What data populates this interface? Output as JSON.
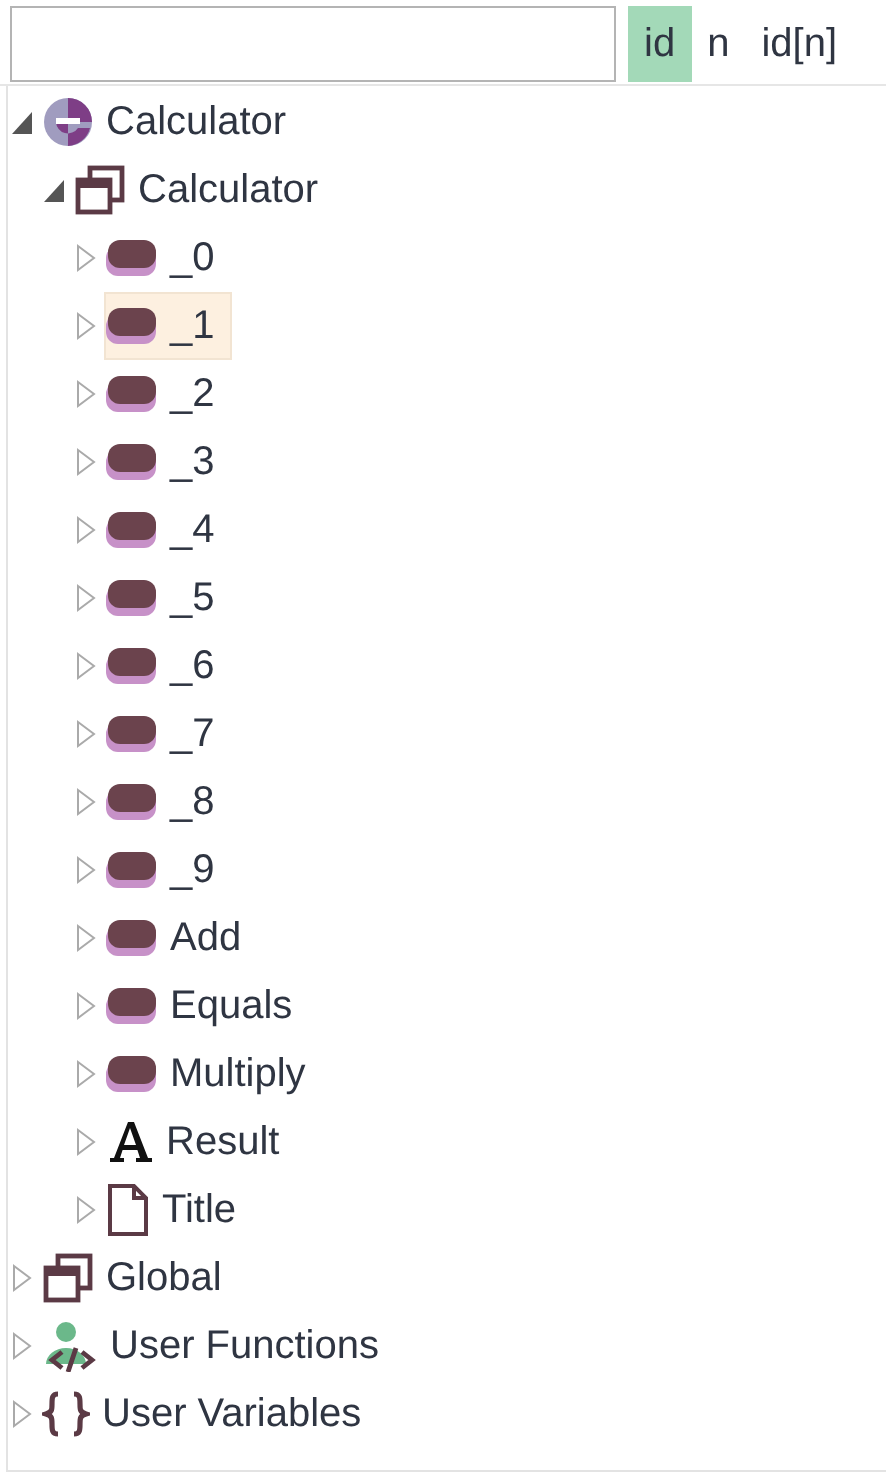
{
  "filter_modes": [
    {
      "label": "id",
      "selected": true
    },
    {
      "label": "n",
      "selected": false
    },
    {
      "label": "id[n]",
      "selected": false
    }
  ],
  "tree": [
    {
      "label": "Calculator",
      "kind": "app",
      "expanded": true,
      "selected": false,
      "children": [
        {
          "label": "Calculator",
          "kind": "window",
          "expanded": true,
          "selected": false,
          "children": [
            {
              "label": "_0",
              "kind": "button",
              "expanded": false,
              "selected": false
            },
            {
              "label": "_1",
              "kind": "button",
              "expanded": false,
              "selected": true
            },
            {
              "label": "_2",
              "kind": "button",
              "expanded": false,
              "selected": false
            },
            {
              "label": "_3",
              "kind": "button",
              "expanded": false,
              "selected": false
            },
            {
              "label": "_4",
              "kind": "button",
              "expanded": false,
              "selected": false
            },
            {
              "label": "_5",
              "kind": "button",
              "expanded": false,
              "selected": false
            },
            {
              "label": "_6",
              "kind": "button",
              "expanded": false,
              "selected": false
            },
            {
              "label": "_7",
              "kind": "button",
              "expanded": false,
              "selected": false
            },
            {
              "label": "_8",
              "kind": "button",
              "expanded": false,
              "selected": false
            },
            {
              "label": "_9",
              "kind": "button",
              "expanded": false,
              "selected": false
            },
            {
              "label": "Add",
              "kind": "button",
              "expanded": false,
              "selected": false
            },
            {
              "label": "Equals",
              "kind": "button",
              "expanded": false,
              "selected": false
            },
            {
              "label": "Multiply",
              "kind": "button",
              "expanded": false,
              "selected": false
            },
            {
              "label": "Result",
              "kind": "text",
              "expanded": false,
              "selected": false
            },
            {
              "label": "Title",
              "kind": "document",
              "expanded": false,
              "selected": false
            }
          ]
        }
      ]
    },
    {
      "label": "Global",
      "kind": "window",
      "expanded": false,
      "selected": false
    },
    {
      "label": "User Functions",
      "kind": "functions",
      "expanded": false,
      "selected": false
    },
    {
      "label": "User Variables",
      "kind": "variables",
      "expanded": false,
      "selected": false
    }
  ]
}
